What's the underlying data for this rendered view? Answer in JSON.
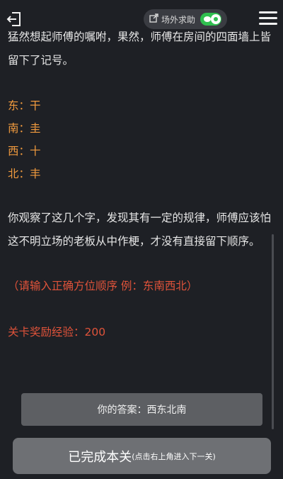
{
  "header": {
    "help_label": "场外求助"
  },
  "story": {
    "line1": "猛然想起师傅的嘱咐，果然，师傅在房间的四面墙上皆",
    "line2": "留下了记号。"
  },
  "clues": [
    {
      "text": "东：干"
    },
    {
      "text": "南：圭"
    },
    {
      "text": "西：十"
    },
    {
      "text": "北：丰"
    }
  ],
  "observation": {
    "line1": "你观察了这几个字，发现其有一定的规律，师傅应该怕",
    "line2": "这不明立场的老板从中作梗，才没有直接留下顺序。"
  },
  "hint": "（请输入正确方位顺序 例：东南西北）",
  "reward": "关卡奖励经验：200",
  "answer": {
    "text": "你的答案：西东北南"
  },
  "done_button": {
    "main": "已完成本关",
    "sub": "(点击右上角进入下一关)"
  },
  "colors": {
    "background": "#1e2025",
    "clue": "#f09a3e",
    "hint": "#e0533a",
    "wechat_green": "#2fbf4f"
  }
}
